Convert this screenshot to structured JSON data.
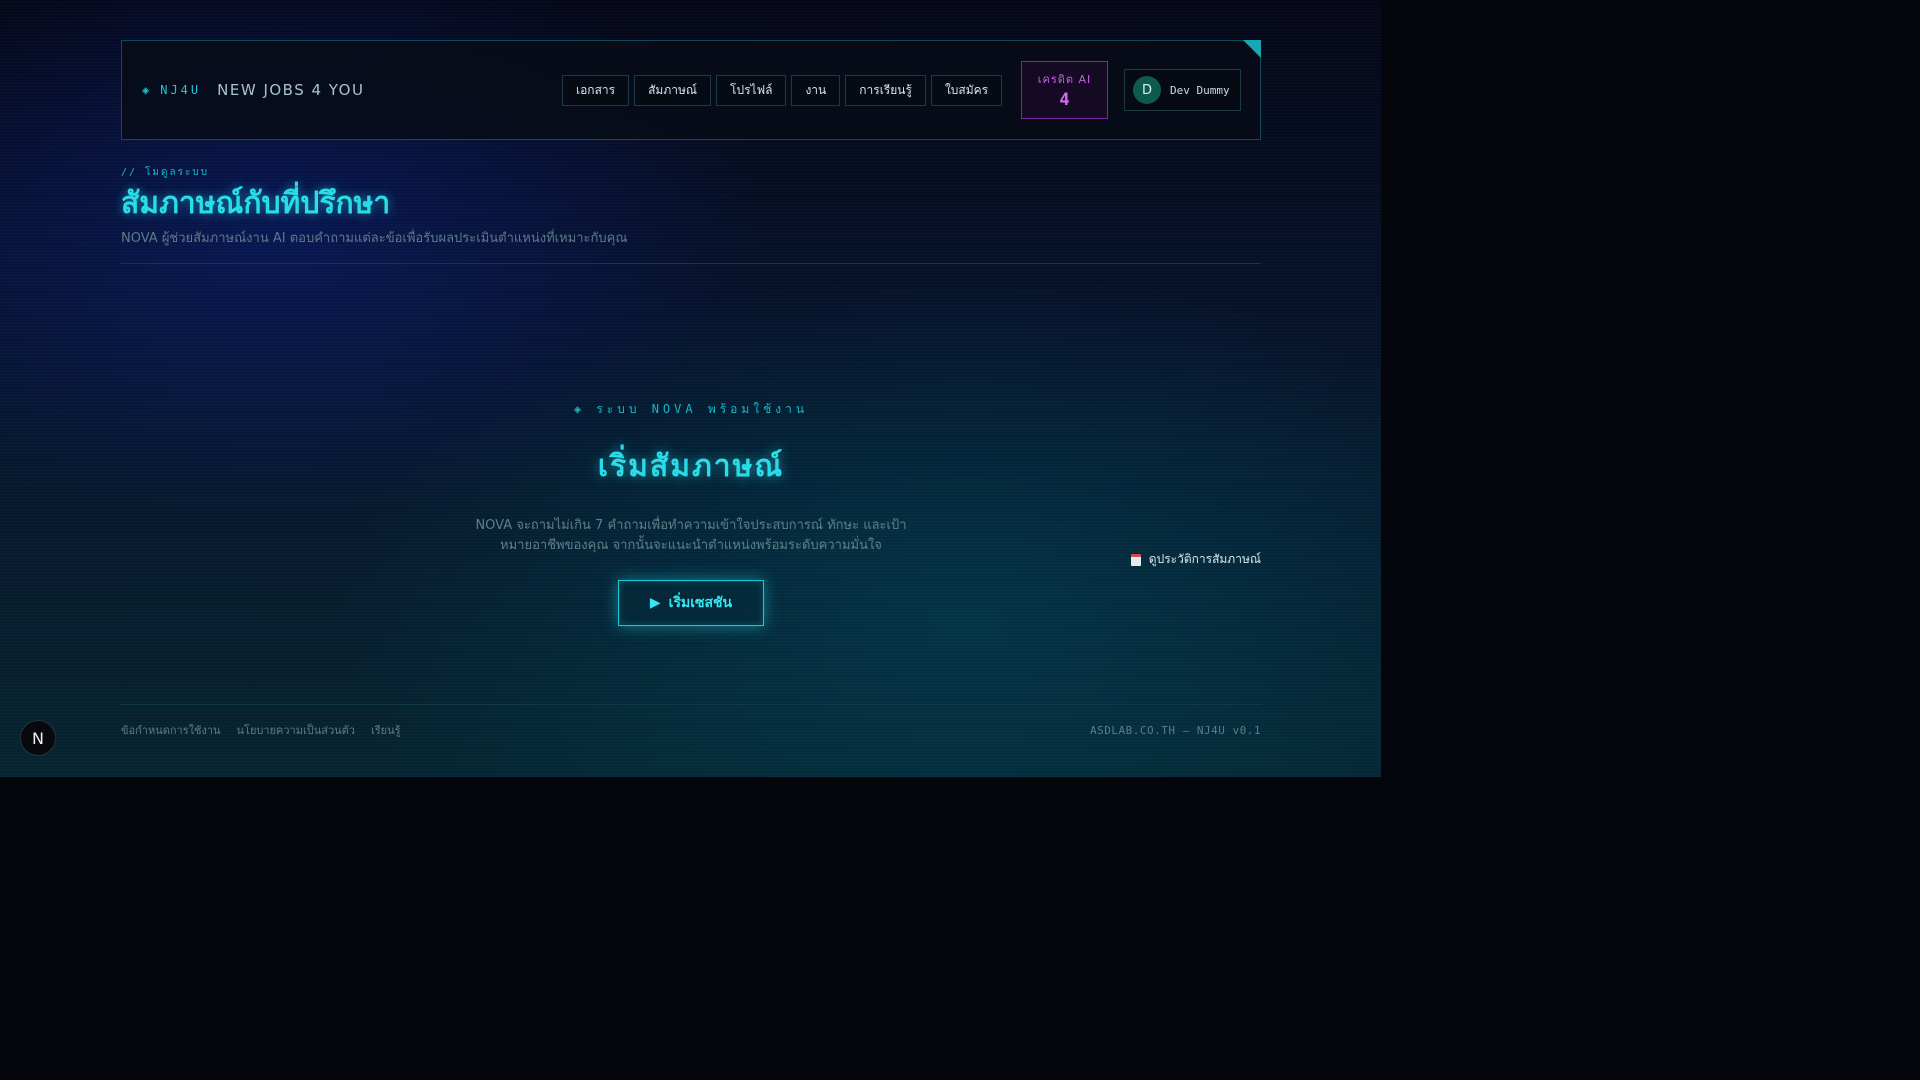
{
  "header": {
    "brand_mark": "NJ4U",
    "brand_name": "NEW JOBS 4 YOU",
    "nav": [
      {
        "label": "เอกสาร"
      },
      {
        "label": "สัมภาษณ์"
      },
      {
        "label": "โปรไฟล์"
      },
      {
        "label": "งาน"
      },
      {
        "label": "การเรียนรู้"
      },
      {
        "label": "ใบสมัคร"
      }
    ],
    "credit": {
      "label": "เครดิต AI",
      "value": "4"
    },
    "user": {
      "initial": "D",
      "name": "Dev Dummy"
    }
  },
  "page": {
    "kicker": "// โมดูลระบบ",
    "title": "สัมภาษณ์กับที่ปรึกษา",
    "subtitle": "NOVA ผู้ช่วยสัมภาษณ์งาน AI ตอบคำถามแต่ละข้อเพื่อรับผลประเมินตำแหน่งที่เหมาะกับคุณ",
    "history_link": "ดูประวัติการสัมภาษณ์"
  },
  "hero": {
    "status": "◈ ระบบ NOVA พร้อมใช้งาน",
    "title": "เริ่มสัมภาษณ์",
    "description": "NOVA จะถามไม่เกิน 7 คำถามเพื่อทำความเข้าใจประสบการณ์ ทักษะ และเป้าหมายอาชีพของคุณ จากนั้นจะแนะนำตำแหน่งพร้อมระดับความมั่นใจ",
    "button_label": "เริ่มเซสชัน"
  },
  "footer": {
    "links": [
      {
        "label": "ข้อกำหนดการใช้งาน"
      },
      {
        "label": "นโยบายความเป็นส่วนตัว"
      },
      {
        "label": "เรียนรู้"
      }
    ],
    "copyright": "ASDLAB.CO.TH — NJ4U v0.1"
  },
  "badge": {
    "label": "N"
  },
  "colors": {
    "accent": "#28dde9",
    "credit": "#c25ee0",
    "background": "#05060c"
  }
}
